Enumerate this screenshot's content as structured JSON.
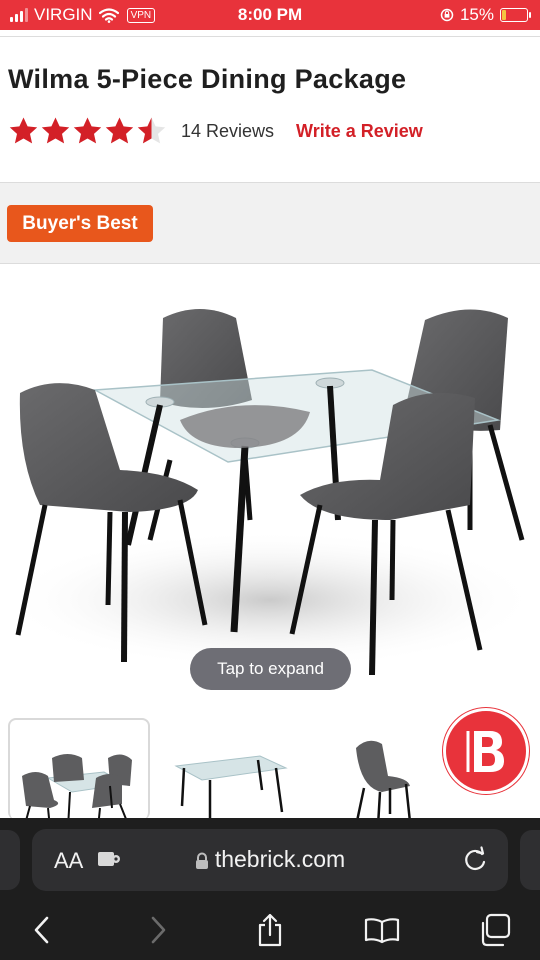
{
  "status_bar": {
    "carrier": "VIRGIN",
    "vpn": "VPN",
    "time": "8:00 PM",
    "battery": "15%",
    "battery_level": 0.15,
    "color": "#e8333b"
  },
  "product": {
    "title": "Wilma 5-Piece Dining Package",
    "rating": 4.5,
    "rating_max": 5,
    "reviews": "14 Reviews",
    "write_review": "Write a Review",
    "badge": "Buyer's Best",
    "tap_to_expand": "Tap to expand"
  },
  "thumbnails": [
    {
      "name": "dining-set",
      "selected": true
    },
    {
      "name": "glass-table",
      "selected": false
    },
    {
      "name": "chair",
      "selected": false
    }
  ],
  "brand_logo": "B",
  "safari": {
    "aa": "AA",
    "url": "thebrick.com",
    "icons": [
      "back-icon",
      "forward-icon",
      "share-icon",
      "bookmarks-icon",
      "tabs-icon"
    ]
  },
  "colors": {
    "brand_red": "#d32027",
    "badge_orange": "#e8571c",
    "star_red": "#d32027",
    "chrome_dark": "#1e1e1e"
  }
}
